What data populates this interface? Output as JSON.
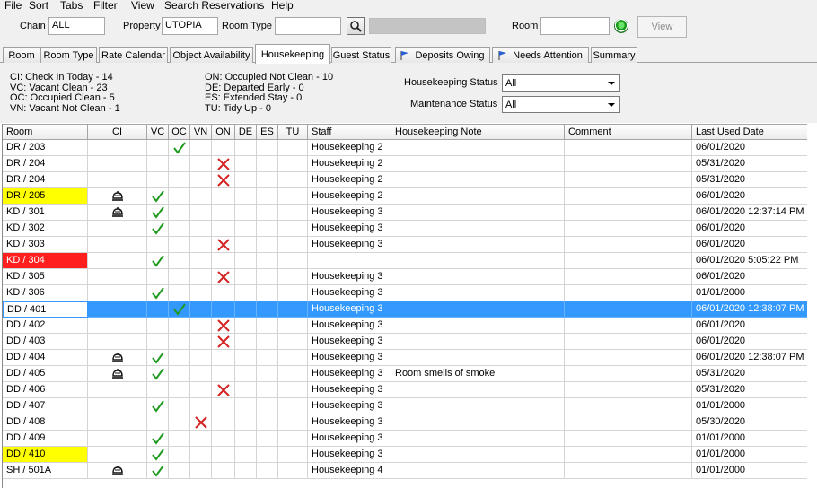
{
  "menu": [
    "File",
    "Sort",
    "Tabs",
    "Filter",
    "View",
    "Search Reservations",
    "Help"
  ],
  "toolbar": {
    "chain_label": "Chain",
    "chain_value": "ALL",
    "property_label": "Property",
    "property_value": "UTOPIA",
    "room_type_label": "Room Type",
    "room_type_value": "",
    "room_label": "Room",
    "room_value": "",
    "view_label": "View"
  },
  "tabs": [
    {
      "label": "Room",
      "flag": false
    },
    {
      "label": "Room Type",
      "flag": false
    },
    {
      "label": "Rate Calendar",
      "flag": false
    },
    {
      "label": "Object Availability",
      "flag": false
    },
    {
      "label": "Housekeeping",
      "flag": false,
      "active": true
    },
    {
      "label": "Guest Status",
      "flag": false
    },
    {
      "label": "Deposits Owing",
      "flag": true
    },
    {
      "label": "Needs Attention",
      "flag": true
    },
    {
      "label": "Summary",
      "flag": false
    }
  ],
  "legend_left": [
    "CI: Check In Today - 14",
    "VC: Vacant Clean - 23",
    "OC: Occupied Clean - 5",
    "VN: Vacant Not Clean - 1"
  ],
  "legend_right": [
    "ON: Occupied Not Clean - 10",
    "DE: Departed Early - 0",
    "ES: Extended Stay - 0",
    "TU: Tidy Up - 0"
  ],
  "filters": {
    "housekeeping_status_label": "Housekeeping Status",
    "housekeeping_status_value": "All",
    "maintenance_status_label": "Maintenance Status",
    "maintenance_status_value": "All"
  },
  "columns": [
    "Room",
    "CI",
    "VC",
    "OC",
    "VN",
    "ON",
    "DE",
    "ES",
    "TU",
    "Staff",
    "Housekeeping Note",
    "Comment",
    "Last Used Date"
  ],
  "colors": {
    "check": "#1f9a1f",
    "cross": "#d42020",
    "highlight_yellow": "#ffff00",
    "highlight_red": "#ff1f1f",
    "selection": "#3399ff"
  },
  "rows": [
    {
      "room": "DR / 203",
      "status": "OC",
      "ci": false,
      "staff": "Housekeeping 2",
      "note": "",
      "comment": "",
      "date": "06/01/2020",
      "highlight": ""
    },
    {
      "room": "DR / 204",
      "status": "ON",
      "ci": false,
      "staff": "Housekeeping 2",
      "note": "",
      "comment": "",
      "date": "05/31/2020",
      "highlight": ""
    },
    {
      "room": "DR / 204",
      "status": "ON",
      "ci": false,
      "staff": "Housekeeping 2",
      "note": "",
      "comment": "",
      "date": "05/31/2020",
      "highlight": ""
    },
    {
      "room": "DR / 205",
      "status": "VC",
      "ci": true,
      "staff": "Housekeeping 2",
      "note": "",
      "comment": "",
      "date": "06/01/2020",
      "highlight": "yellow"
    },
    {
      "room": "KD / 301",
      "status": "VC",
      "ci": true,
      "staff": "Housekeeping 3",
      "note": "",
      "comment": "",
      "date": "06/01/2020 12:37:14 PM",
      "highlight": ""
    },
    {
      "room": "KD / 302",
      "status": "VC",
      "ci": false,
      "staff": "Housekeeping 3",
      "note": "",
      "comment": "",
      "date": "06/01/2020",
      "highlight": ""
    },
    {
      "room": "KD / 303",
      "status": "ON",
      "ci": false,
      "staff": "Housekeeping 3",
      "note": "",
      "comment": "",
      "date": "06/01/2020",
      "highlight": ""
    },
    {
      "room": "KD / 304",
      "status": "VC",
      "ci": false,
      "staff": "",
      "note": "",
      "comment": "",
      "date": "06/01/2020 5:05:22 PM",
      "highlight": "red"
    },
    {
      "room": "KD / 305",
      "status": "ON",
      "ci": false,
      "staff": "Housekeeping 3",
      "note": "",
      "comment": "",
      "date": "06/01/2020",
      "highlight": ""
    },
    {
      "room": "KD / 306",
      "status": "VC",
      "ci": false,
      "staff": "Housekeeping 3",
      "note": "",
      "comment": "",
      "date": "01/01/2000",
      "highlight": ""
    },
    {
      "room": "DD / 401",
      "status": "OC",
      "ci": false,
      "staff": "Housekeeping 3",
      "note": "",
      "comment": "",
      "date": "06/01/2020 12:38:07 PM",
      "highlight": "",
      "selected": true
    },
    {
      "room": "DD / 402",
      "status": "ON",
      "ci": false,
      "staff": "Housekeeping 3",
      "note": "",
      "comment": "",
      "date": "06/01/2020",
      "highlight": ""
    },
    {
      "room": "DD / 403",
      "status": "ON",
      "ci": false,
      "staff": "Housekeeping 3",
      "note": "",
      "comment": "",
      "date": "06/01/2020",
      "highlight": ""
    },
    {
      "room": "DD / 404",
      "status": "VC",
      "ci": true,
      "staff": "Housekeeping 3",
      "note": "",
      "comment": "",
      "date": "06/01/2020 12:38:07 PM",
      "highlight": ""
    },
    {
      "room": "DD / 405",
      "status": "VC",
      "ci": true,
      "staff": "Housekeeping 3",
      "note": "Room smells of smoke",
      "comment": "",
      "date": "05/31/2020",
      "highlight": ""
    },
    {
      "room": "DD / 406",
      "status": "ON",
      "ci": false,
      "staff": "Housekeeping 3",
      "note": "",
      "comment": "",
      "date": "05/31/2020",
      "highlight": ""
    },
    {
      "room": "DD / 407",
      "status": "VC",
      "ci": false,
      "staff": "Housekeeping 3",
      "note": "",
      "comment": "",
      "date": "01/01/2000",
      "highlight": ""
    },
    {
      "room": "DD / 408",
      "status": "VN",
      "ci": false,
      "staff": "Housekeeping 3",
      "note": "",
      "comment": "",
      "date": "05/30/2020",
      "highlight": ""
    },
    {
      "room": "DD / 409",
      "status": "VC",
      "ci": false,
      "staff": "Housekeeping 3",
      "note": "",
      "comment": "",
      "date": "01/01/2000",
      "highlight": ""
    },
    {
      "room": "DD / 410",
      "status": "VC",
      "ci": false,
      "staff": "Housekeeping 3",
      "note": "",
      "comment": "",
      "date": "01/01/2000",
      "highlight": "yellow"
    },
    {
      "room": "SH / 501A",
      "status": "VC",
      "ci": true,
      "staff": "Housekeeping 4",
      "note": "",
      "comment": "",
      "date": "01/01/2000",
      "highlight": ""
    }
  ]
}
